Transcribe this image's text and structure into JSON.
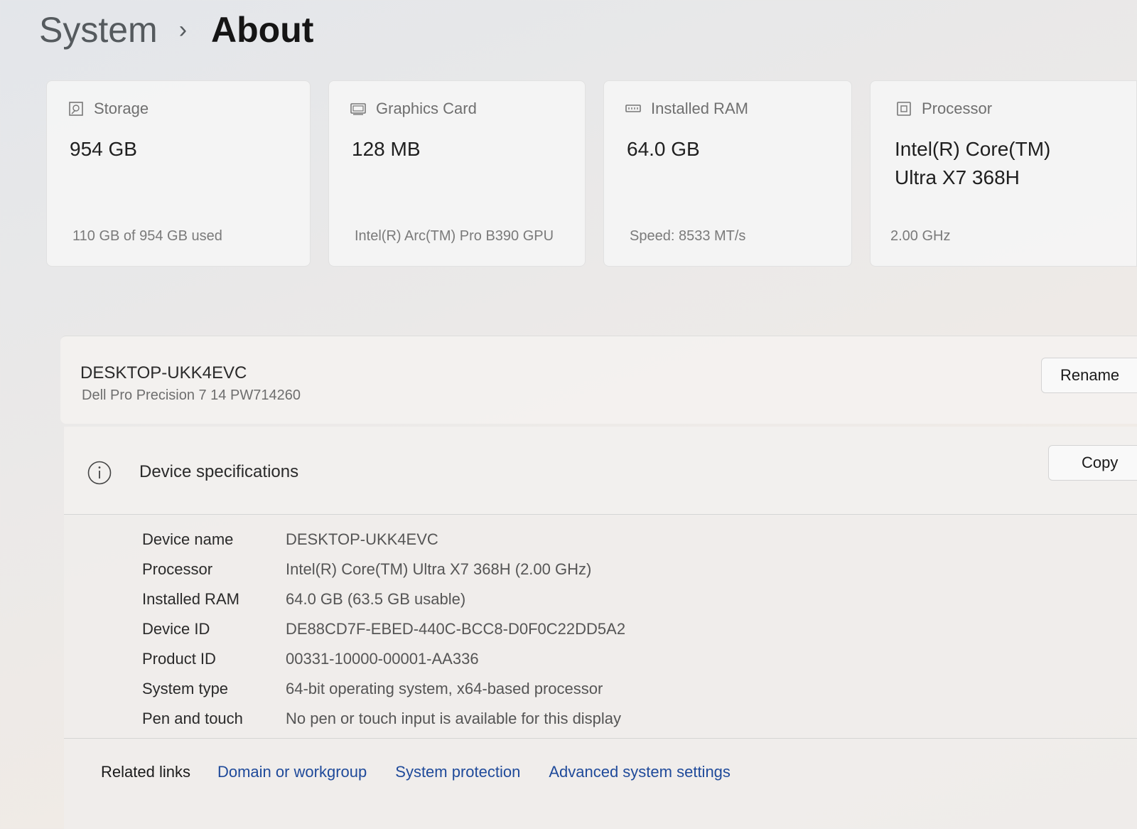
{
  "breadcrumb": {
    "parent": "System",
    "separator": "›",
    "current": "About"
  },
  "cards": [
    {
      "icon": "storage-icon",
      "label": "Storage",
      "value": "954 GB",
      "sub": "110 GB of 954 GB used"
    },
    {
      "icon": "graphics-card-icon",
      "label": "Graphics Card",
      "value": "128 MB",
      "sub": "Intel(R) Arc(TM) Pro B390 GPU"
    },
    {
      "icon": "ram-icon",
      "label": "Installed RAM",
      "value": "64.0 GB",
      "sub": "Speed: 8533 MT/s"
    },
    {
      "icon": "processor-icon",
      "label": "Processor",
      "value": "Intel(R) Core(TM) Ultra X7 368H",
      "sub": "2.00 GHz"
    }
  ],
  "device": {
    "name": "DESKTOP-UKK4EVC",
    "model": "Dell Pro Precision 7 14 PW714260",
    "rename_label": "Rename"
  },
  "specifications": {
    "title": "Device specifications",
    "copy_label": "Copy",
    "rows": [
      {
        "key": "Device name",
        "value": "DESKTOP-UKK4EVC"
      },
      {
        "key": "Processor",
        "value": "Intel(R) Core(TM) Ultra X7 368H (2.00 GHz)"
      },
      {
        "key": "Installed RAM",
        "value": "64.0 GB (63.5 GB usable)"
      },
      {
        "key": "Device ID",
        "value": "DE88CD7F-EBED-440C-BCC8-D0F0C22DD5A2"
      },
      {
        "key": "Product ID",
        "value": "00331-10000-00001-AA336"
      },
      {
        "key": "System type",
        "value": "64-bit operating system, x64-based processor"
      },
      {
        "key": "Pen and touch",
        "value": "No pen or touch input is available for this display"
      }
    ]
  },
  "related": {
    "label": "Related links",
    "links": [
      "Domain or workgroup",
      "System protection",
      "Advanced system settings"
    ]
  },
  "colors": {
    "link": "#1f4a9a",
    "card_background": "#f6f6f6"
  }
}
